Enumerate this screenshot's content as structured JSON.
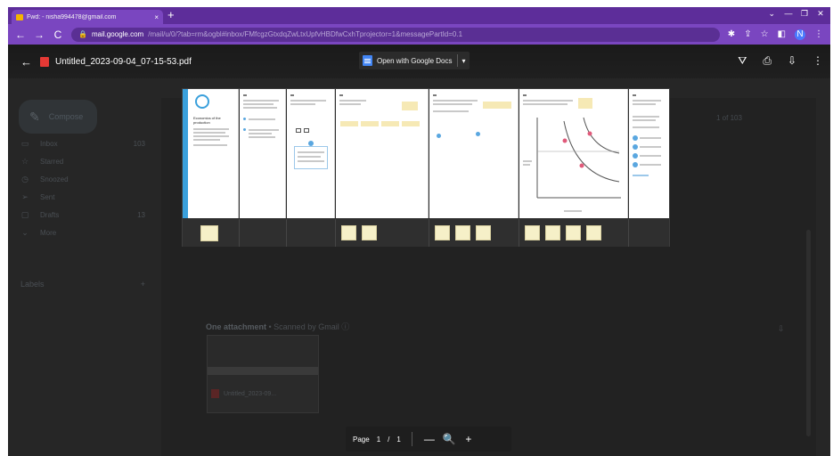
{
  "browser": {
    "tab_title": "Fwd: - nisha994478@gmail.com",
    "tab_close": "×",
    "new_tab": "+",
    "address_host": "mail.google.com",
    "address_path": "/mail/u/0/?tab=rm&ogbl#inbox/FMfcgzGtxdqZwLtxUpfvHBDfwCxhTprojector=1&messagePartId=0.1",
    "win_minimize": "—",
    "win_restore": "❐",
    "win_close": "✕",
    "tab_menu": "⌄",
    "profile_initial": "N"
  },
  "gmail": {
    "compose_label": "Compose",
    "nav": [
      {
        "label": "Inbox",
        "count": "103",
        "icon": "inbox-icon",
        "glyph": "▭"
      },
      {
        "label": "Starred",
        "count": "",
        "icon": "star-icon",
        "glyph": "☆"
      },
      {
        "label": "Snoozed",
        "count": "",
        "icon": "clock-icon",
        "glyph": "◷"
      },
      {
        "label": "Sent",
        "count": "",
        "icon": "send-icon",
        "glyph": "➢"
      },
      {
        "label": "Drafts",
        "count": "13",
        "icon": "draft-icon",
        "glyph": "▢"
      },
      {
        "label": "More",
        "count": "",
        "icon": "chevron-down-icon",
        "glyph": "⌄"
      }
    ],
    "labels_heading": "Labels",
    "labels_add": "+",
    "attachment_heading": "One attachment",
    "attachment_sub": " • Scanned by Gmail ⓘ",
    "attachment_filename": "Untitled_2023-09...",
    "pager_text": "1 of 103"
  },
  "viewer": {
    "file_name": "Untitled_2023-09-04_07-15-53.pdf",
    "open_with_label": "Open with Google Docs",
    "page_label": "Page",
    "current_page": "1",
    "page_separator": "/",
    "total_pages": "1",
    "zoom_out": "—",
    "zoom_icon": "🔍",
    "zoom_in": "+"
  },
  "pdf_page_text": {
    "title": "Economics of the production"
  },
  "colors": {
    "tab_strip": "#5d2d9a",
    "toolbar": "#7a46c0",
    "pdf_red": "#e53935",
    "docs_blue": "#4285f4"
  }
}
